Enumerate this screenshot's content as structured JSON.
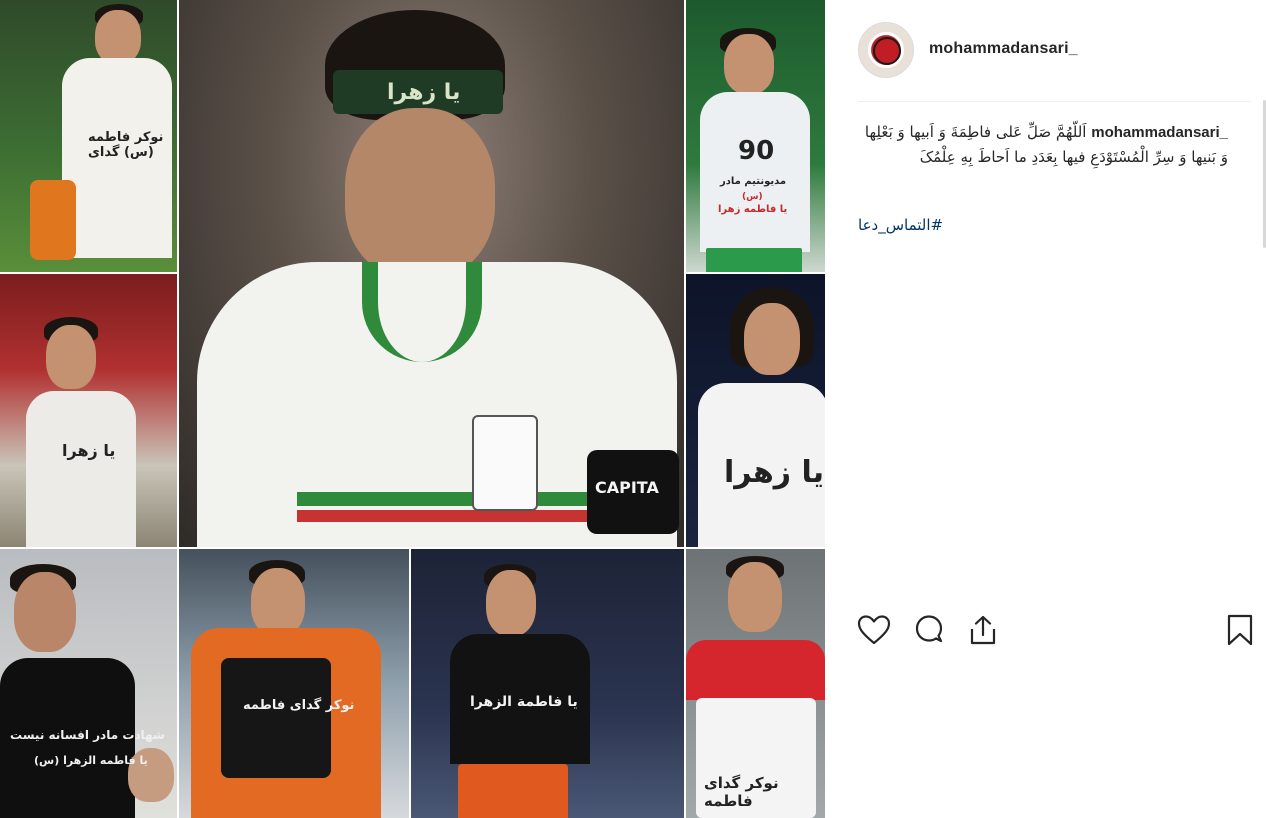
{
  "post": {
    "username": "mohammadansari_",
    "caption": {
      "author": "mohammadansari_",
      "text": "اَللّهُمَّ صَلِّ عَلی فاطِمَةَ وَ اَبیها وَ بَعْلِها وَ بَنیها وَ سِرِّ الْمُسْتَوْدَعِ فیها بِعَدَدِ ما اَحاطَ بِهِ عِلْمُکَ"
    },
    "hashtag": "#التماس_دعا",
    "actions": {
      "like_icon": "heart-icon",
      "comment_icon": "comment-bubble-icon",
      "share_icon": "share-upload-icon",
      "save_icon": "bookmark-icon"
    }
  },
  "collage": {
    "shirt_texts": {
      "top_left": "نوکر فاطمه (س) گدای",
      "mid_left": "یا زهرا",
      "center_headband": "یا زهرا",
      "center_armband": "CAPITA",
      "top_right_number": "90",
      "top_right_line1": "مدیونتیم مادر",
      "top_right_line2": "(س)",
      "top_right_line3": "یا فاطمه زهرا",
      "mid_right": "یا زهرا",
      "bottom_left_line1": "شهادت مادر افسانه نیست",
      "bottom_left_line2": "یا فاطمه الزهرا (س)",
      "bottom_mid": "نوکر گدای فاطمه",
      "bottom_center": "یا فاطمة الزهرا",
      "bottom_right": "نوکر گدای فاطمه"
    }
  },
  "colors": {
    "text": "#262626",
    "hashtag": "#003569",
    "divider": "#efefef",
    "icon": "#262626"
  }
}
